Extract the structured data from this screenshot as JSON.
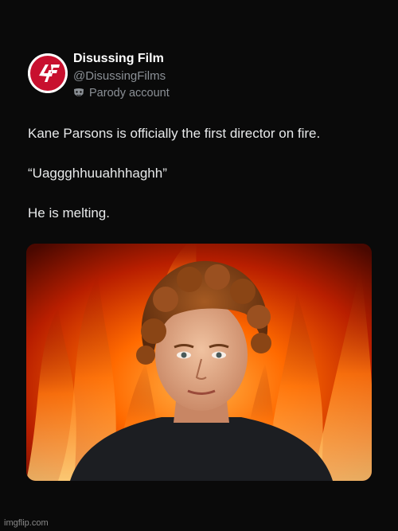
{
  "account": {
    "display_name": "Disussing Film",
    "handle": "@DisussingFilms",
    "parody_label": "Parody account",
    "avatar_icon": "logo-4f-icon",
    "parody_icon": "mask-icon"
  },
  "tweet": {
    "lines": [
      "Kane Parsons is officially the first director on fire.",
      "“Uaggghhuuahhhaghh”",
      "He is melting."
    ]
  },
  "media": {
    "description_icon": "photo-man-flames"
  },
  "watermark": "imgflip.com",
  "colors": {
    "background": "#0a0a0a",
    "logo_red": "#c8102e",
    "muted_text": "#8b9096",
    "flame_orange": "#ff6a00"
  }
}
